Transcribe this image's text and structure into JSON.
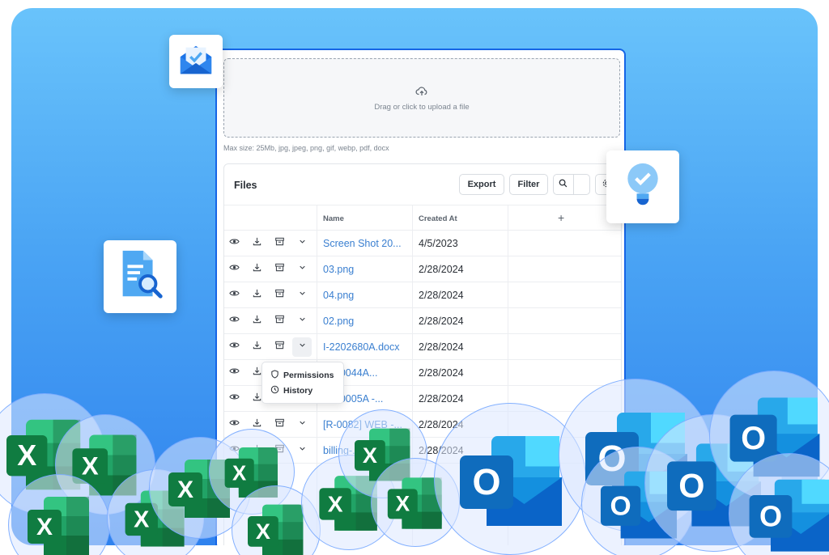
{
  "upload": {
    "prompt": "Drag or click to upload a file",
    "max_size": "Max size: 25Mb, jpg, jpeg, png, gif, webp, pdf, docx",
    "icon": "cloud-upload-icon"
  },
  "files": {
    "title": "Files",
    "export_label": "Export",
    "filter_label": "Filter",
    "columns": {
      "name": "Name",
      "created_at": "Created At",
      "add": "+"
    },
    "rows": [
      {
        "name": "Screen Shot 20...",
        "created": "4/5/2023"
      },
      {
        "name": "03.png",
        "created": "2/28/2024"
      },
      {
        "name": "04.png",
        "created": "2/28/2024"
      },
      {
        "name": "02.png",
        "created": "2/28/2024"
      },
      {
        "name": "I-2202680A.docx",
        "created": "2/28/2024"
      },
      {
        "name": "0000044A...",
        "created": "2/28/2024"
      },
      {
        "name": "0000005A -...",
        "created": "2/28/2024"
      },
      {
        "name": "[R-0082] WEB -...",
        "created": "2/28/2024"
      },
      {
        "name": "billing-...",
        "created": "2/28/2024"
      }
    ],
    "row_actions": [
      "eye-icon",
      "download-icon",
      "archive-icon",
      "chevron-down-icon"
    ]
  },
  "menu": {
    "permissions": "Permissions",
    "history": "History"
  },
  "decor": {
    "tiles": [
      "envelope-check-icon",
      "lightbulb-check-icon",
      "document-search-icon"
    ],
    "bubble_letters": {
      "excel": "X",
      "outlook": "O"
    }
  },
  "colors": {
    "accent": "#1565e6",
    "link": "#3a7fd0",
    "excel": "#1f7a45",
    "outlook": "#1670d6",
    "background_top": "#69c3fb",
    "background_bottom": "#2f82ee"
  }
}
